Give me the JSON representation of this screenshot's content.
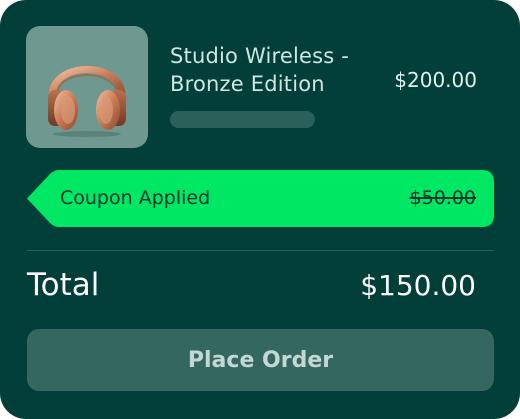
{
  "product": {
    "name_line1": "Studio Wireless -",
    "name_line2": "Bronze Edition",
    "price": "$200.00",
    "thumbnail_icon": "headphones-icon"
  },
  "coupon": {
    "label": "Coupon Applied",
    "discount": "$50.00"
  },
  "total": {
    "label": "Total",
    "value": "$150.00"
  },
  "actions": {
    "place_order_label": "Place Order"
  },
  "colors": {
    "card_background": "#023f38",
    "coupon_green": "#00e863",
    "button_background": "#346760",
    "thumbnail_background": "#6f9891"
  }
}
